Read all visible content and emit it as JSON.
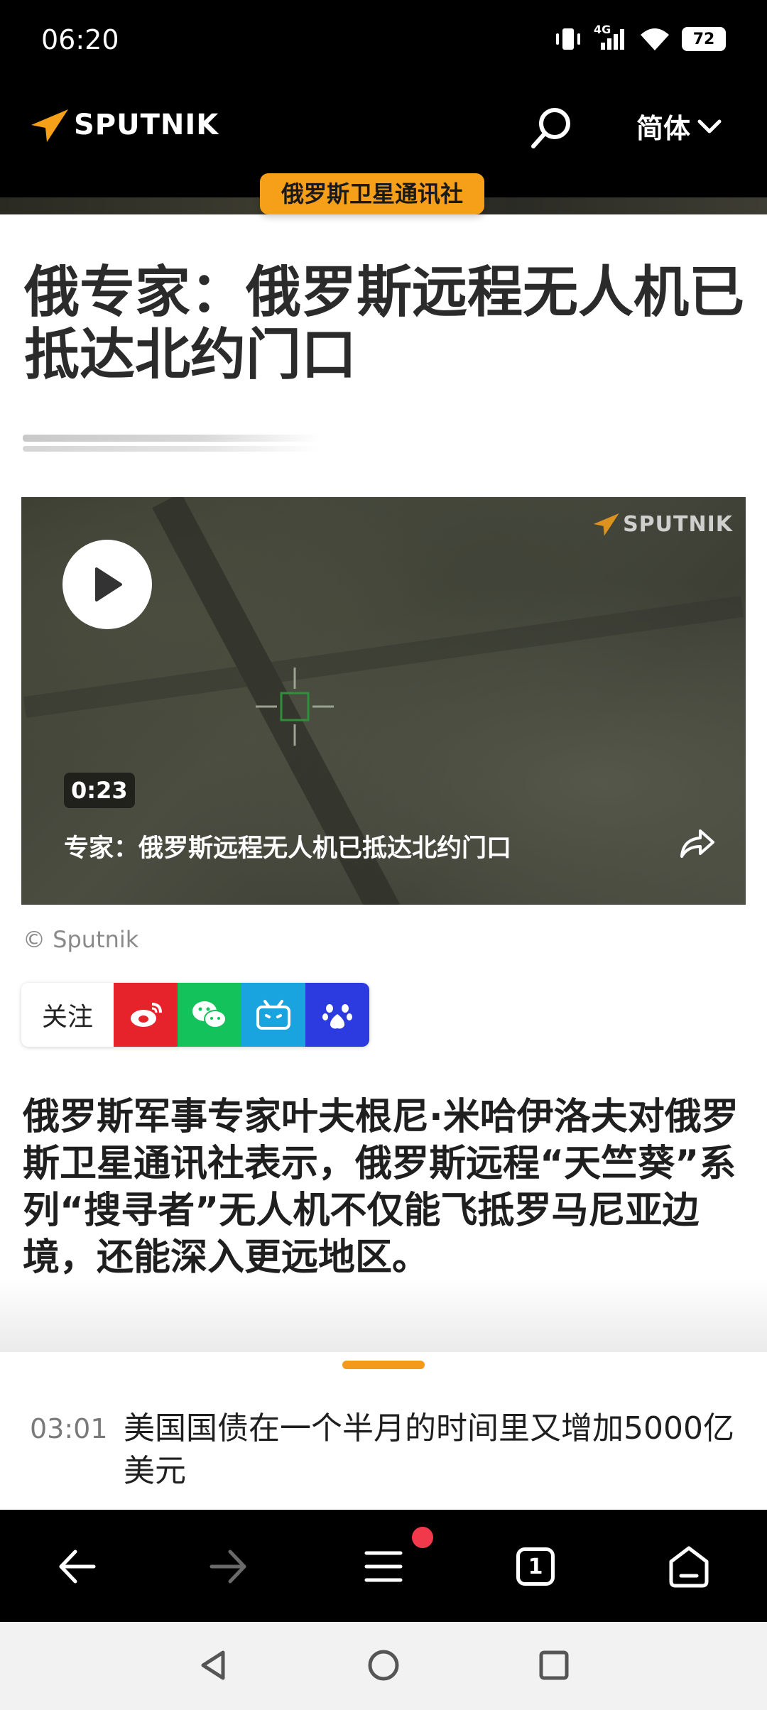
{
  "status": {
    "time": "06:20",
    "network": "4G",
    "battery": "72"
  },
  "header": {
    "brand": "SPUTNIK",
    "language": "简体",
    "section_badge": "俄罗斯卫星通讯社"
  },
  "article": {
    "title": "俄专家：俄罗斯远程无人机已抵达北约门口",
    "video": {
      "watermark": "SPUTNIK",
      "duration": "0:23",
      "caption": "专家：俄罗斯远程无人机已抵达北约门口"
    },
    "credit": "© Sputnik",
    "follow_label": "关注",
    "lead": "俄罗斯军事专家叶夫根尼·米哈伊洛夫对俄罗斯卫星通讯社表示，俄罗斯远程“天竺葵”系列“搜寻者”无人机不仅能飞抵罗马尼亚边境，还能深入更远地区。"
  },
  "ticker": {
    "time": "03:01",
    "headline": "美国国债在一个半月的时间里又增加5000亿美元"
  },
  "browser_bar": {
    "tabs_count": "1"
  },
  "colors": {
    "accent": "#f6a01a",
    "notification": "#f0394a"
  }
}
